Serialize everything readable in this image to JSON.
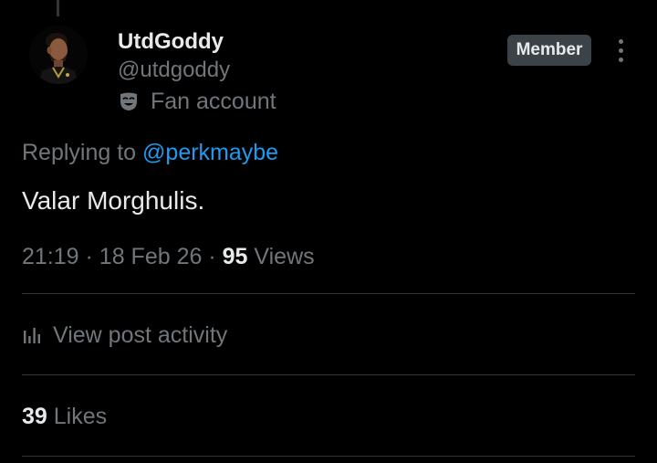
{
  "author": {
    "display_name": "UtdGoddy",
    "handle": "@utdgoddy",
    "label_icon": "theater-mask-icon",
    "label": "Fan account",
    "badge": "Member"
  },
  "reply": {
    "prefix": "Replying to",
    "mention": "@perkmaybe"
  },
  "post": {
    "text": "Valar Morghulis."
  },
  "meta": {
    "time": "21:19",
    "sep1": "·",
    "date": "18 Feb 26",
    "sep2": "·",
    "views_count": "95",
    "views_label": "Views"
  },
  "activity": {
    "icon": "bar-chart-icon",
    "label": "View post activity"
  },
  "likes": {
    "count": "39",
    "label": "Likes"
  },
  "colors": {
    "background": "#000000",
    "primary_text": "#e7e9ea",
    "secondary_text": "#71767b",
    "link": "#1d9bf0",
    "divider": "#2f3336",
    "badge_bg": "#3c4348"
  }
}
